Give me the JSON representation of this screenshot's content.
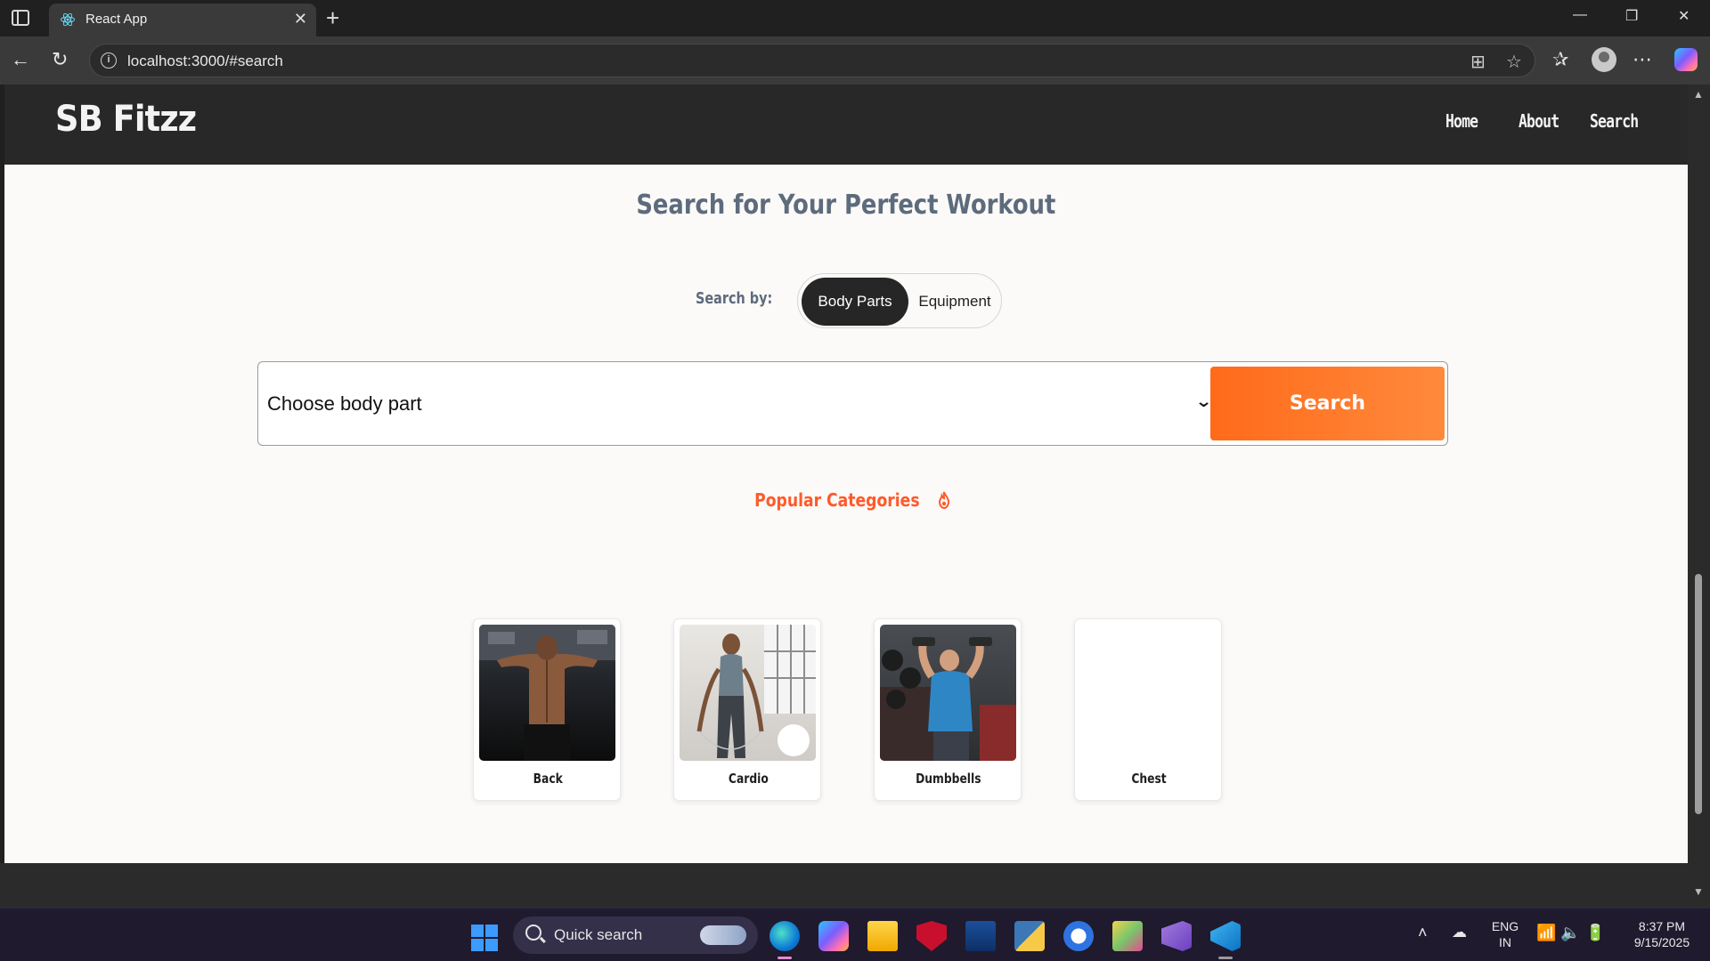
{
  "browser": {
    "tab_title": "React App",
    "url": "localhost:3000/#search"
  },
  "site": {
    "logo": "SB Fitzz",
    "nav": [
      "Home",
      "About",
      "Search"
    ]
  },
  "search_page": {
    "title": "Search for Your Perfect Workout",
    "search_by_label": "Search by:",
    "toggle_options": [
      "Body Parts",
      "Equipment"
    ],
    "toggle_selected": "Body Parts",
    "select_placeholder": "Choose body part",
    "search_button": "Search",
    "popular_title": "Popular Categories",
    "categories": [
      {
        "label": "Back",
        "image": "back-workout-photo"
      },
      {
        "label": "Cardio",
        "image": "cardio-jump-rope-photo"
      },
      {
        "label": "Dumbbells",
        "image": "dumbbell-press-photo"
      },
      {
        "label": "Chest",
        "image": ""
      }
    ]
  },
  "taskbar": {
    "search_placeholder": "Quick search",
    "language": "ENG",
    "region": "IN",
    "time": "8:37 PM",
    "date": "9/15/2025"
  },
  "colors": {
    "accent_orange": "#ff6a1a",
    "heading_slate": "#5d6b7d",
    "header_dark": "#282828",
    "page_bg": "#fbfaf8"
  }
}
